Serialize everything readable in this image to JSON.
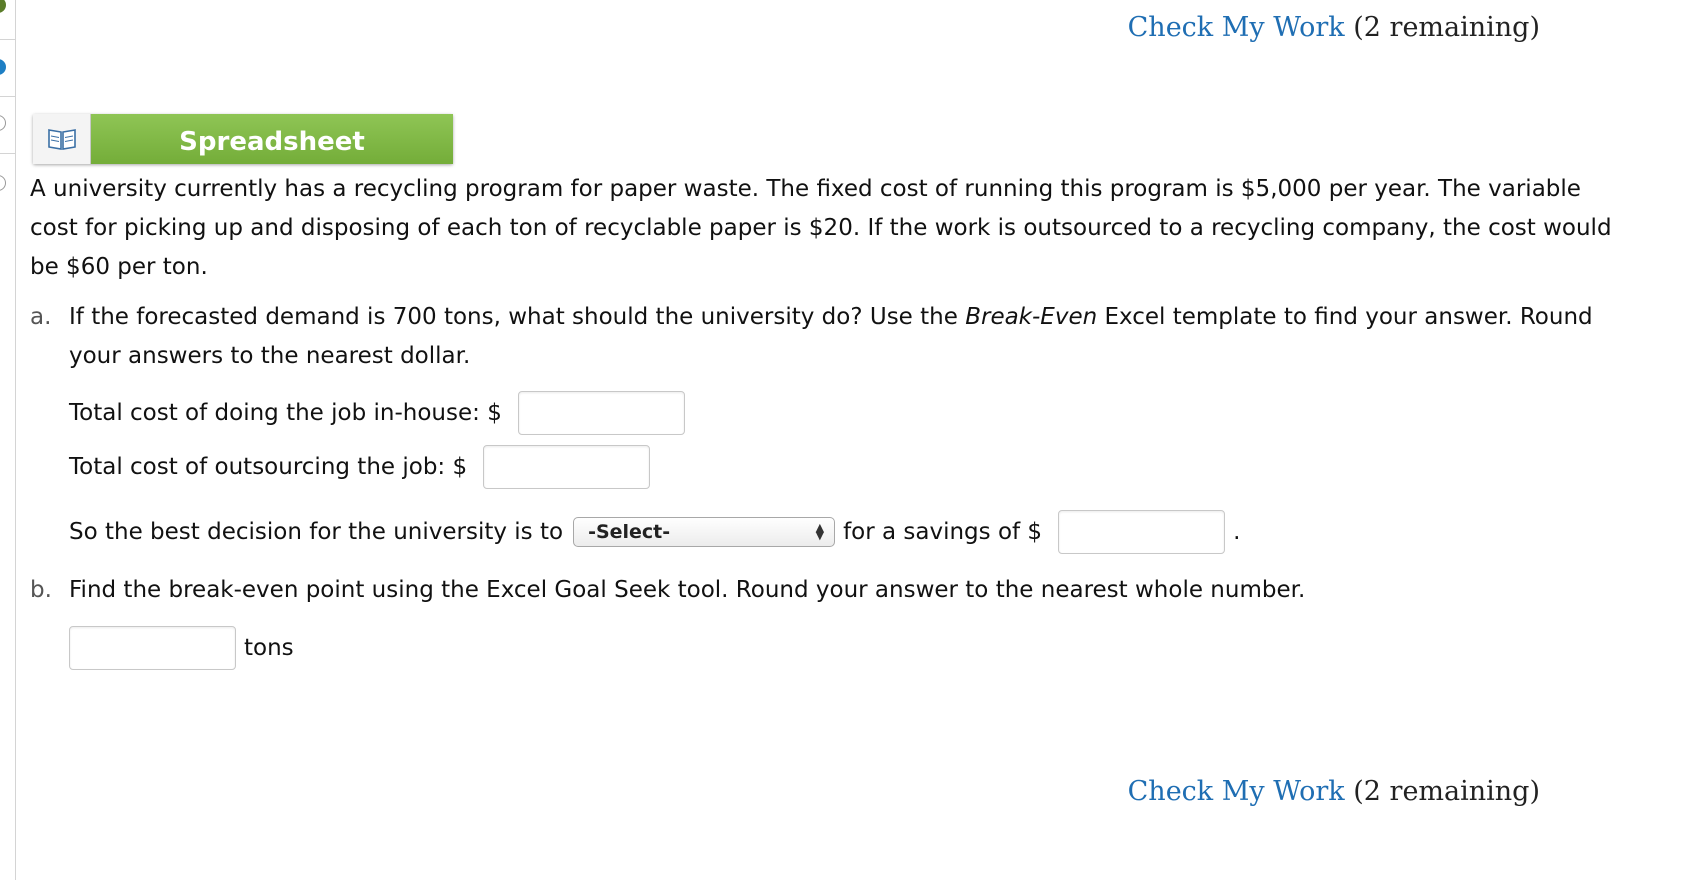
{
  "check_work": {
    "link_label": "Check My Work",
    "remaining": "(2 remaining)"
  },
  "spreadsheet": {
    "label": "Spreadsheet",
    "icon": "book-icon"
  },
  "problem": {
    "lines": [
      "A university currently has a recycling program for paper waste. The fixed cost of running this program is $5,000 per year. The variable",
      "cost for picking up and disposing of each ton of recyclable paper is $20. If the work is outsourced to a recycling company, the cost would",
      "be $60 per ton."
    ]
  },
  "part_a": {
    "label": "a.",
    "line1_before": "If the forecasted demand is 700 tons, what should the university do? Use the ",
    "line1_italic": "Break-Even",
    "line1_after": " Excel template to find your answer. Round",
    "line2": "your answers to the nearest dollar.",
    "inhouse_label": "Total cost of doing the job in-house: $",
    "inhouse_value": "",
    "outsource_label": "Total cost of outsourcing the job: $",
    "outsource_value": "",
    "decision_label": "So the best decision for the university is to",
    "decision_selected": "-Select-",
    "savings_label": "for a savings of $",
    "savings_value": "",
    "end_period": "."
  },
  "part_b": {
    "label": "b.",
    "text": "Find the break-even point using the Excel Goal Seek tool. Round your answer to the nearest whole number.",
    "answer_value": "",
    "unit": "tons"
  }
}
